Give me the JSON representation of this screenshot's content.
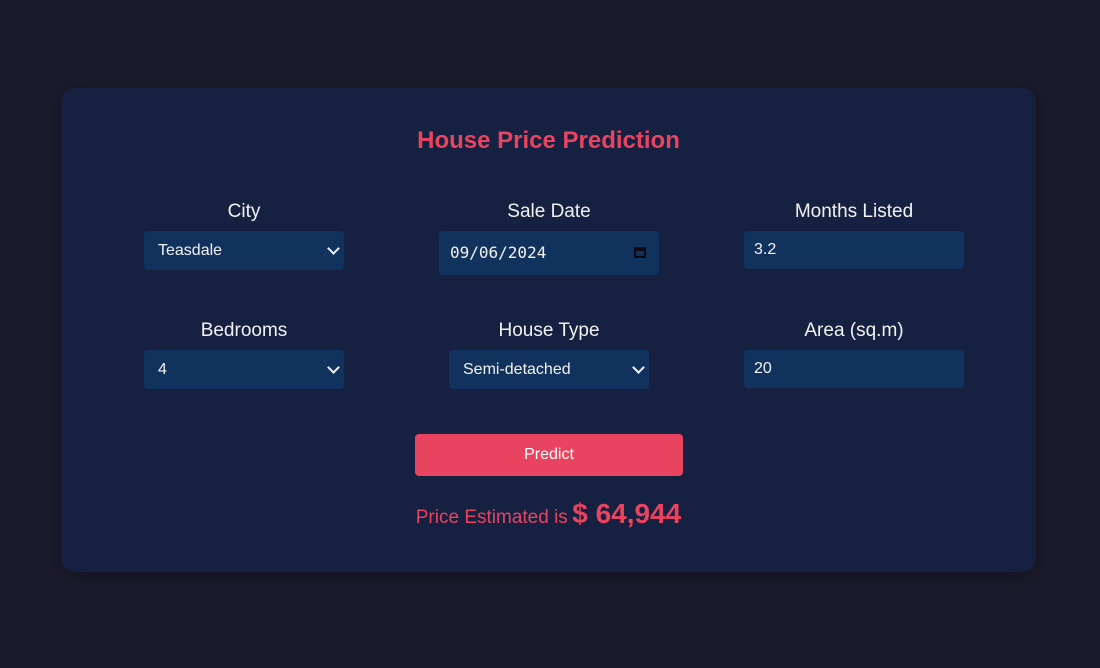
{
  "colors": {
    "page_background": "#1b1b2d",
    "card_background": "#162040",
    "control_background": "#12325e",
    "accent": "#e8445f",
    "text": "#f2f2f2"
  },
  "form": {
    "title": "House Price Prediction",
    "city": {
      "label": "City",
      "value": "Teasdale"
    },
    "sale_date": {
      "label": "Sale Date",
      "value": "09/06/2024"
    },
    "months_listed": {
      "label": "Months Listed",
      "value": "3.2"
    },
    "bedrooms": {
      "label": "Bedrooms",
      "value": "4"
    },
    "house_type": {
      "label": "House Type",
      "value": "Semi-detached"
    },
    "area": {
      "label": "Area (sq.m)",
      "value": "20"
    },
    "predict_label": "Predict"
  },
  "result": {
    "prefix": "Price Estimated is",
    "amount": "$ 64,944"
  },
  "icons": {
    "select_arrow": "chevron-down-icon",
    "date_picker": "calendar-icon"
  }
}
